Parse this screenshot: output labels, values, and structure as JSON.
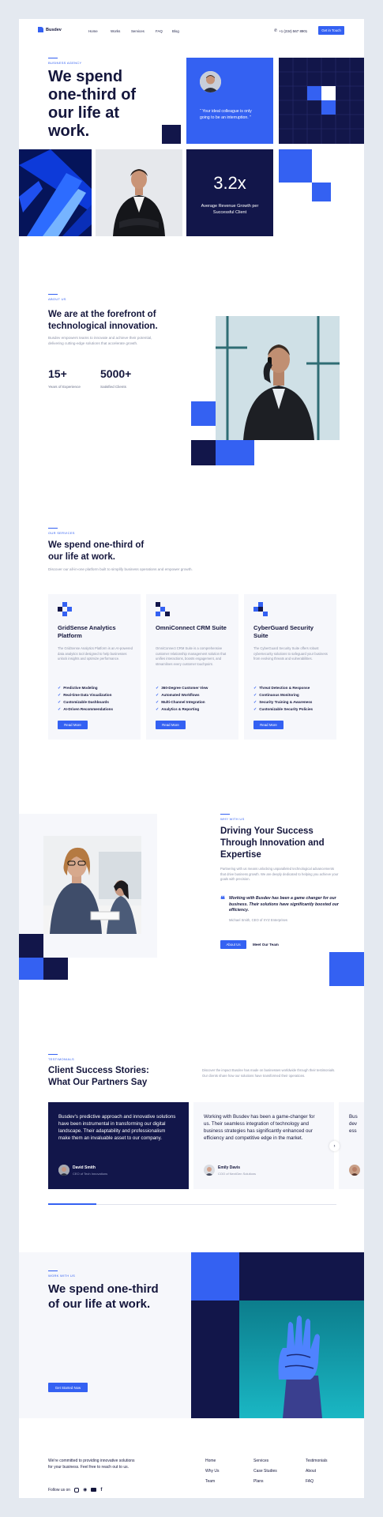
{
  "brand": {
    "name": "Busdev"
  },
  "nav": {
    "items": [
      "Home",
      "Works",
      "Services",
      "FAQ",
      "Blog"
    ],
    "phone": "+1 (234) 567 8901",
    "cta": "Get in Touch"
  },
  "hero": {
    "eyebrow": "BUSINESS AGENCY",
    "title": "We spend one-third of our life at work.",
    "quote": "“ Your ideal colleague is only going to be an interruption. ”",
    "stat_value": "3.2x",
    "stat_label": "Average Revenue Growth per Successful Client"
  },
  "about": {
    "eyebrow": "ABOUT US",
    "title": "We are at the forefront of technological innovation.",
    "text": "Busdev empowers teams to innovate and achieve their potential, delivering cutting-edge solutions that accelerate growth.",
    "stats": [
      {
        "value": "15+",
        "label": "Years of Experience"
      },
      {
        "value": "5000+",
        "label": "Satisfied Clients"
      }
    ]
  },
  "services": {
    "eyebrow": "OUR SERVICES",
    "title": "We spend one-third of our life at work.",
    "text": "Discover our all-in-one platform built to simplify business operations and empower growth.",
    "cards": [
      {
        "title": "GridSense Analytics Platform",
        "text": "The GridSense Analytics Platform is an AI-powered data analytics tool designed to help businesses unlock insights and optimize performance.",
        "features": [
          "Predictive Modeling",
          "Real-time Data Visualization",
          "Customizable Dashboards",
          "AI-Driven Recommendations"
        ],
        "button": "Read More"
      },
      {
        "title": "OmniConnect CRM Suite",
        "text": "OmniConnect CRM Suite is a comprehensive customer relationship management solution that unifies interactions, boosts engagement, and streamlines every customer touchpoint.",
        "features": [
          "360-Degree Customer View",
          "Automated Workflows",
          "Multi-Channel Integration",
          "Analytics & Reporting"
        ],
        "button": "Read More"
      },
      {
        "title": "CyberGuard Security Suite",
        "text": "The CyberGuard Security Suite offers robust cybersecurity solutions to safeguard your business from evolving threats and vulnerabilities.",
        "features": [
          "Threat Detection & Response",
          "Continuous Monitoring",
          "Security Training & Awareness",
          "Customizable Security Policies"
        ],
        "button": "Read More"
      }
    ]
  },
  "why": {
    "eyebrow": "WHY WITH US",
    "title": "Driving Your Success Through Innovation and Expertise",
    "text": "Partnering with us means unlocking unparalleled technological advancements that drive business growth. We are deeply dedicated to helping you achieve your goals with precision.",
    "quote": "Working with Busdev has been a game changer for our business. Their solutions have significantly boosted our efficiency.",
    "quote_author": "Michael Smith, CEO of XYZ Enterprises",
    "primary_button": "About Us",
    "secondary_button": "Meet Our Team"
  },
  "testimonials": {
    "eyebrow": "TESTIMONIALS",
    "title": "Client Success Stories: What Our Partners Say",
    "text": "Discover the impact Busdev has made on businesses worldwide through their testimonials. Our clients share how our solutions have transformed their operations.",
    "items": [
      {
        "text": "Busdev's predictive approach and innovative solutions have been instrumental in transforming our digital landscape. Their adaptability and professionalism make them an invaluable asset to our company.",
        "name": "David Smith",
        "role": "CEO of Tech Innovations"
      },
      {
        "text": "Working with Busdev has been a game-changer for us. Their seamless integration of technology and business strategies has significantly enhanced our efficiency and competitive edge in the market.",
        "name": "Emily Davis",
        "role": "COO of NextGen Solutions"
      },
      {
        "text": "Bus dev ess",
        "name": "",
        "role": ""
      }
    ]
  },
  "cta_section": {
    "eyebrow": "WORK WITH US",
    "title": "We spend one-third of our life at work.",
    "button": "Get Started Now"
  },
  "footer": {
    "text": "We're committed to providing innovative solutions for your business. Feel free to reach out to us.",
    "follow": "Follow us on",
    "col1": [
      "Home",
      "Why Us",
      "Team"
    ],
    "col2": [
      "Services",
      "Case Studies",
      "Plans"
    ],
    "col3": [
      "Testimonials",
      "About",
      "FAQ"
    ]
  },
  "colors": {
    "accent": "#3461f2",
    "navy": "#12164a",
    "soft_bg": "#f6f7fb"
  }
}
